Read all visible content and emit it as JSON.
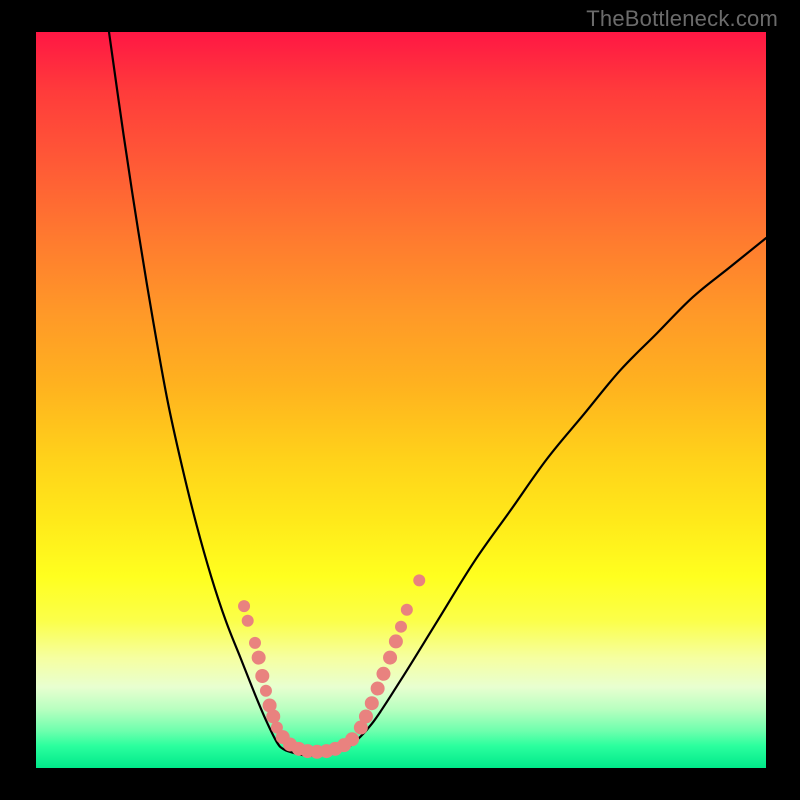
{
  "watermark": "TheBottleneck.com",
  "colors": {
    "curve_stroke": "#000000",
    "marker_fill": "#e9827f",
    "marker_stroke": "#d46a67",
    "background_frame": "#000000"
  },
  "chart_data": {
    "type": "line",
    "title": "",
    "xlabel": "",
    "ylabel": "",
    "xlim": [
      0,
      100
    ],
    "ylim": [
      0,
      100
    ],
    "grid": false,
    "legend": false,
    "series": [
      {
        "name": "curve-left",
        "x": [
          10,
          12,
          14,
          16,
          18,
          20,
          22,
          24,
          26,
          28,
          30,
          31.5,
          33
        ],
        "y": [
          100,
          86,
          73,
          61,
          50,
          41,
          33,
          26,
          20,
          15,
          10,
          6.5,
          3.5
        ]
      },
      {
        "name": "curve-bottom",
        "x": [
          33,
          34,
          35.5,
          37,
          38.5,
          40,
          41.5,
          43
        ],
        "y": [
          3.5,
          2.5,
          2.0,
          1.7,
          1.7,
          1.9,
          2.3,
          3.0
        ]
      },
      {
        "name": "curve-right",
        "x": [
          43,
          46,
          50,
          55,
          60,
          65,
          70,
          75,
          80,
          85,
          90,
          95,
          100
        ],
        "y": [
          3.0,
          6.0,
          12,
          20,
          28,
          35,
          42,
          48,
          54,
          59,
          64,
          68,
          72
        ]
      }
    ],
    "markers": [
      {
        "x": 28.5,
        "y": 22.0,
        "r": 6
      },
      {
        "x": 29.0,
        "y": 20.0,
        "r": 6
      },
      {
        "x": 30.0,
        "y": 17.0,
        "r": 6
      },
      {
        "x": 30.5,
        "y": 15.0,
        "r": 7
      },
      {
        "x": 31.0,
        "y": 12.5,
        "r": 7
      },
      {
        "x": 31.5,
        "y": 10.5,
        "r": 6
      },
      {
        "x": 32.0,
        "y": 8.5,
        "r": 7
      },
      {
        "x": 32.5,
        "y": 7.0,
        "r": 7
      },
      {
        "x": 33.0,
        "y": 5.5,
        "r": 6
      },
      {
        "x": 33.8,
        "y": 4.2,
        "r": 7
      },
      {
        "x": 34.8,
        "y": 3.2,
        "r": 7
      },
      {
        "x": 36.0,
        "y": 2.6,
        "r": 7
      },
      {
        "x": 37.2,
        "y": 2.3,
        "r": 7
      },
      {
        "x": 38.5,
        "y": 2.2,
        "r": 7
      },
      {
        "x": 39.8,
        "y": 2.3,
        "r": 7
      },
      {
        "x": 41.0,
        "y": 2.6,
        "r": 7
      },
      {
        "x": 42.2,
        "y": 3.1,
        "r": 7
      },
      {
        "x": 43.3,
        "y": 3.9,
        "r": 7
      },
      {
        "x": 44.5,
        "y": 5.5,
        "r": 7
      },
      {
        "x": 45.2,
        "y": 7.0,
        "r": 7
      },
      {
        "x": 46.0,
        "y": 8.8,
        "r": 7
      },
      {
        "x": 46.8,
        "y": 10.8,
        "r": 7
      },
      {
        "x": 47.6,
        "y": 12.8,
        "r": 7
      },
      {
        "x": 48.5,
        "y": 15.0,
        "r": 7
      },
      {
        "x": 49.3,
        "y": 17.2,
        "r": 7
      },
      {
        "x": 50.0,
        "y": 19.2,
        "r": 6
      },
      {
        "x": 50.8,
        "y": 21.5,
        "r": 6
      },
      {
        "x": 52.5,
        "y": 25.5,
        "r": 6
      }
    ]
  }
}
